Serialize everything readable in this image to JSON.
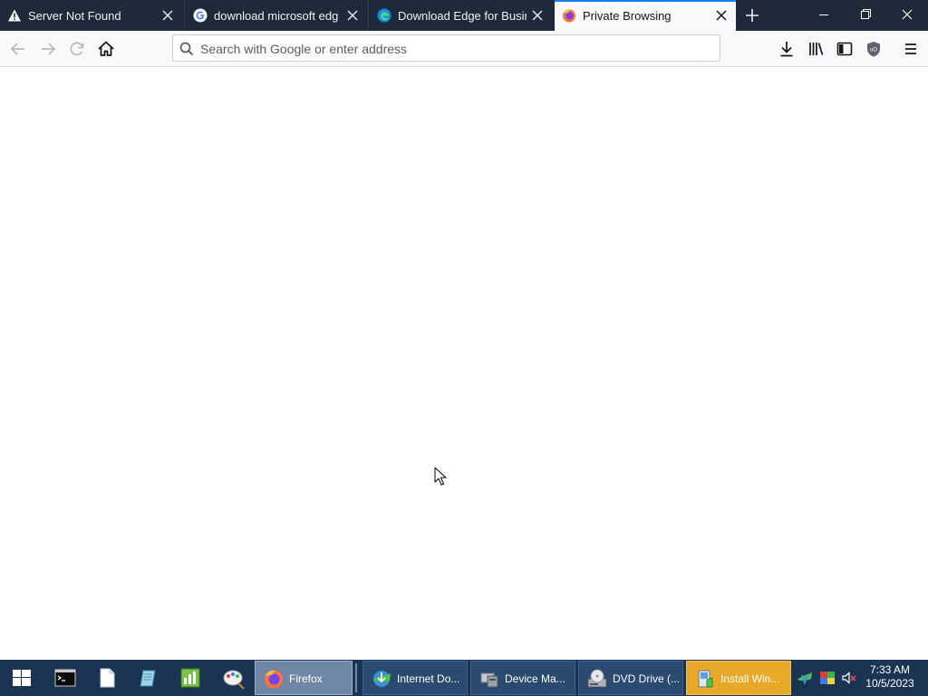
{
  "browser": {
    "tabs": [
      {
        "title": "Server Not Found",
        "icon": "warning-icon"
      },
      {
        "title": "download microsoft edge - Goo",
        "icon": "google-icon"
      },
      {
        "title": "Download Edge for Business",
        "icon": "edge-icon"
      },
      {
        "title": "Private Browsing",
        "icon": "firefox-icon",
        "active": true
      }
    ],
    "urlbar": {
      "placeholder": "Search with Google or enter address"
    },
    "accent_color": "#0a84ff"
  },
  "taskbar": {
    "pinned": [
      {
        "name": "start-icon"
      },
      {
        "name": "terminal-icon"
      },
      {
        "name": "file-icon"
      },
      {
        "name": "notepad-icon"
      },
      {
        "name": "chart-icon"
      },
      {
        "name": "paint-icon"
      }
    ],
    "buttons": [
      {
        "label": "Firefox",
        "icon": "firefox-icon",
        "state": "active"
      },
      {
        "label": "Internet Do...",
        "icon": "idm-icon",
        "state": "normal"
      },
      {
        "label": "Device Ma...",
        "icon": "device-manager-icon",
        "state": "normal"
      },
      {
        "label": "DVD Drive (...",
        "icon": "dvd-icon",
        "state": "normal"
      },
      {
        "label": "Install Win...",
        "icon": "installer-icon",
        "state": "flashing"
      }
    ],
    "clock": {
      "time": "7:33 AM",
      "date": "10/5/2023"
    }
  }
}
